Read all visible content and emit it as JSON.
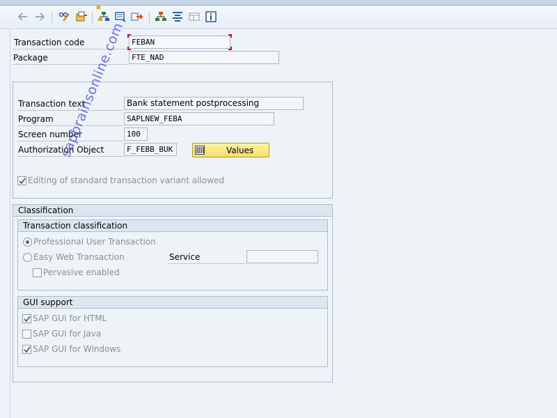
{
  "toolbar": {
    "icons": [
      "back-arrow-icon",
      "forward-arrow-icon",
      "edit-glasses-icon",
      "object-list-icon",
      "hierarchy-icon",
      "display-object-icon",
      "move-icon",
      "tree-icon",
      "outline-icon",
      "layout-icon",
      "info-icon"
    ]
  },
  "header": {
    "transaction_code_label": "Transaction code",
    "transaction_code_value": "FEBAN",
    "package_label": "Package",
    "package_value": "FTE_NAD"
  },
  "details": {
    "transaction_text_label": "Transaction text",
    "transaction_text_value": "Bank statement postprocessing",
    "program_label": "Program",
    "program_value": "SAPLNEW_FEBA",
    "screen_number_label": "Screen number",
    "screen_number_value": "100",
    "auth_object_label": "Authorization Object",
    "auth_object_value": "F_FEBB_BUK",
    "values_button": "Values",
    "editing_variant_label": "Editing of standard transaction variant allowed",
    "editing_variant_checked": true
  },
  "classification": {
    "title": "Classification",
    "transaction_classification": {
      "title": "Transaction classification",
      "professional_label": "Professional User Transaction",
      "easy_web_label": "Easy Web Transaction",
      "service_label": "Service",
      "service_value": "",
      "pervasive_label": "Pervasive enabled",
      "selected": "professional"
    },
    "gui_support": {
      "title": "GUI support",
      "html_label": "SAP GUI for HTML",
      "html_checked": true,
      "java_label": "SAP GUI for Java",
      "java_checked": false,
      "windows_label": "SAP GUI for Windows",
      "windows_checked": true
    }
  },
  "watermark": "sapbrainsonline.com",
  "colors": {
    "background": "#eef3f8",
    "values_button": "#f5df6a",
    "focus_marker": "#c81b1b",
    "watermark": "#3c3ce6"
  }
}
